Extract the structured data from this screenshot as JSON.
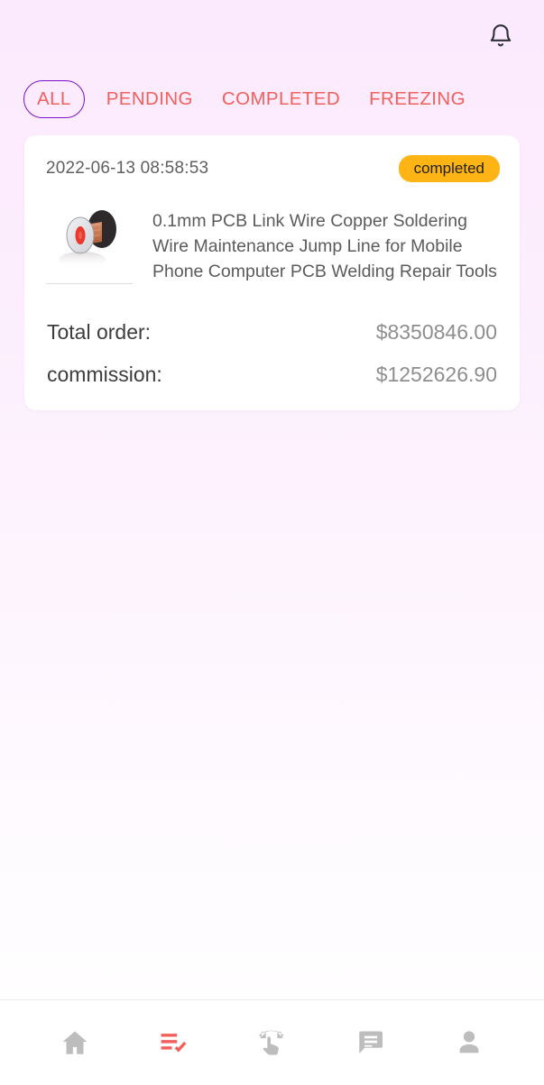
{
  "header": {
    "notification_icon": "bell-icon"
  },
  "tabs": [
    {
      "label": "ALL",
      "active": true
    },
    {
      "label": "PENDING",
      "active": false
    },
    {
      "label": "COMPLETED",
      "active": false
    },
    {
      "label": "FREEZING",
      "active": false
    }
  ],
  "order": {
    "date": "2022-06-13 08:58:53",
    "status": "completed",
    "status_color": "#fdb414",
    "product_title": "0.1mm PCB Link Wire Copper Soldering Wire Maintenance Jump Line for Mobile Phone Computer PCB Welding Repair Tools",
    "product_image_alt": "copper-wire-spool",
    "rows": [
      {
        "label": "Total order:",
        "value": "$8350846.00"
      },
      {
        "label": "commission:",
        "value": "$1252626.90"
      }
    ]
  },
  "bottom_nav": [
    {
      "icon": "home-icon",
      "active": false
    },
    {
      "icon": "playlist-check-icon",
      "active": true
    },
    {
      "icon": "swipe-gesture-icon",
      "active": false
    },
    {
      "icon": "chat-bubble-icon",
      "active": false
    },
    {
      "icon": "person-icon",
      "active": false
    }
  ],
  "colors": {
    "tab_text": "#f2605c",
    "tab_active_border": "#7a12c9",
    "accent_red": "#f2605c",
    "nav_inactive": "#bdbdbd",
    "background_top": "#fbeafd",
    "background_bottom": "#ffffff"
  }
}
